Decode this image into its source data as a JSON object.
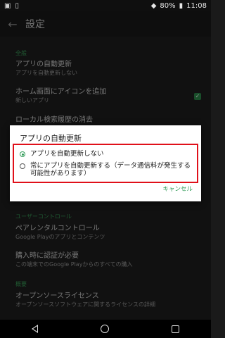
{
  "status_bar": {
    "battery": "80%",
    "time": "11:08",
    "icons": [
      "photo-icon",
      "vibrate-icon",
      "wifi-icon",
      "battery-icon"
    ]
  },
  "app_bar": {
    "title": "設定",
    "back_icon": "arrow-left-icon"
  },
  "settings": {
    "general_header": "全般",
    "auto_update": {
      "title": "アプリの自動更新",
      "subtitle": "アプリを自動更新しない"
    },
    "add_icon": {
      "title": "ホーム画面にアイコンを追加",
      "subtitle": "新しいアプリ",
      "checked": true
    },
    "clear_history": {
      "title": "ローカル検索履歴の消去"
    },
    "user_controls_header": "ユーザーコントロール",
    "parental": {
      "title": "ペアレンタルコントロール",
      "subtitle": "Google Playのアプリとコンテンツ"
    },
    "require_auth": {
      "title": "購入時に認証が必要",
      "subtitle": "この端末でのGoogle Playからのすべての購入"
    },
    "about_header": "概要",
    "oss": {
      "title": "オープンソースライセンス",
      "subtitle": "オープンソースソフトウェアに関するライセンスの詳細"
    }
  },
  "dialog": {
    "title": "アプリの自動更新",
    "options": [
      {
        "label": "アプリを自動更新しない",
        "selected": true
      },
      {
        "label": "常にアプリを自動更新する（データ通信料が発生する可能性があります）",
        "selected": false
      }
    ],
    "cancel": "キャンセル",
    "highlight_color": "#e0101a",
    "accent_color": "#2f9a56"
  }
}
